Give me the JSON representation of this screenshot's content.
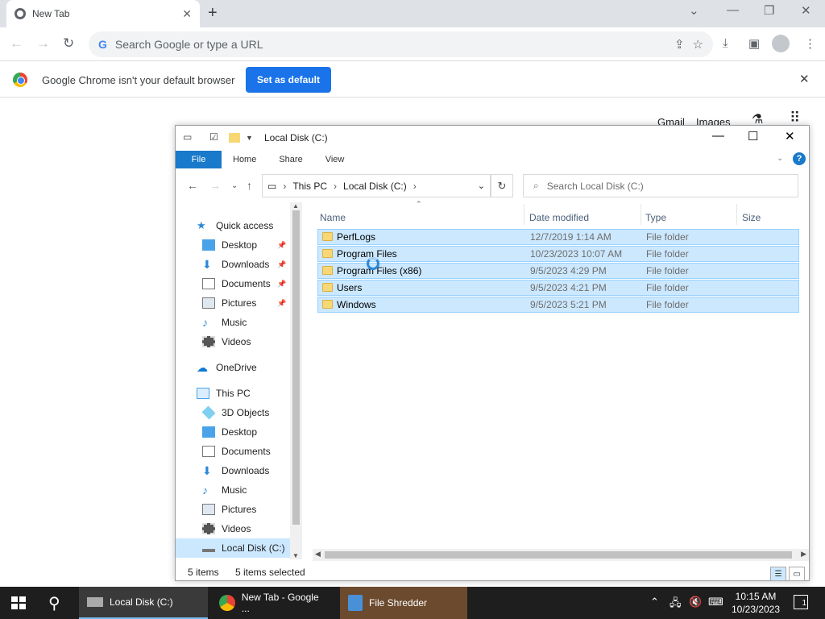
{
  "browser": {
    "tab_title": "New Tab",
    "omnibox_placeholder": "Search Google or type a URL",
    "infobar_text": "Google Chrome isn't your default browser",
    "set_default_label": "Set as default",
    "gmail_label": "Gmail",
    "images_label": "Images"
  },
  "explorer": {
    "title": "Local Disk (C:)",
    "ribbon_tabs": [
      "File",
      "Home",
      "Share",
      "View"
    ],
    "address": {
      "pc": "This PC",
      "drive": "Local Disk (C:)"
    },
    "search_placeholder": "Search Local Disk (C:)",
    "nav": {
      "quick_access": "Quick access",
      "qa_items": [
        "Desktop",
        "Downloads",
        "Documents",
        "Pictures",
        "Music",
        "Videos"
      ],
      "onedrive": "OneDrive",
      "this_pc": "This PC",
      "pc_items": [
        "3D Objects",
        "Desktop",
        "Documents",
        "Downloads",
        "Music",
        "Pictures",
        "Videos",
        "Local Disk (C:)"
      ]
    },
    "columns": [
      "Name",
      "Date modified",
      "Type",
      "Size"
    ],
    "files": [
      {
        "name": "PerfLogs",
        "date": "12/7/2019 1:14 AM",
        "type": "File folder"
      },
      {
        "name": "Program Files",
        "date": "10/23/2023 10:07 AM",
        "type": "File folder"
      },
      {
        "name": "Program Files (x86)",
        "date": "9/5/2023 4:29 PM",
        "type": "File folder"
      },
      {
        "name": "Users",
        "date": "9/5/2023 4:21 PM",
        "type": "File folder"
      },
      {
        "name": "Windows",
        "date": "9/5/2023 5:21 PM",
        "type": "File folder"
      }
    ],
    "status_items": "5 items",
    "status_selected": "5 items selected"
  },
  "taskbar": {
    "items": [
      "Local Disk (C:)",
      "New Tab - Google ...",
      "File Shredder"
    ],
    "time": "10:15 AM",
    "date": "10/23/2023",
    "notification_count": "1"
  },
  "colors": {
    "selection": "#cce8ff",
    "accent": "#1979ca",
    "chrome_blue": "#1a73e8"
  }
}
